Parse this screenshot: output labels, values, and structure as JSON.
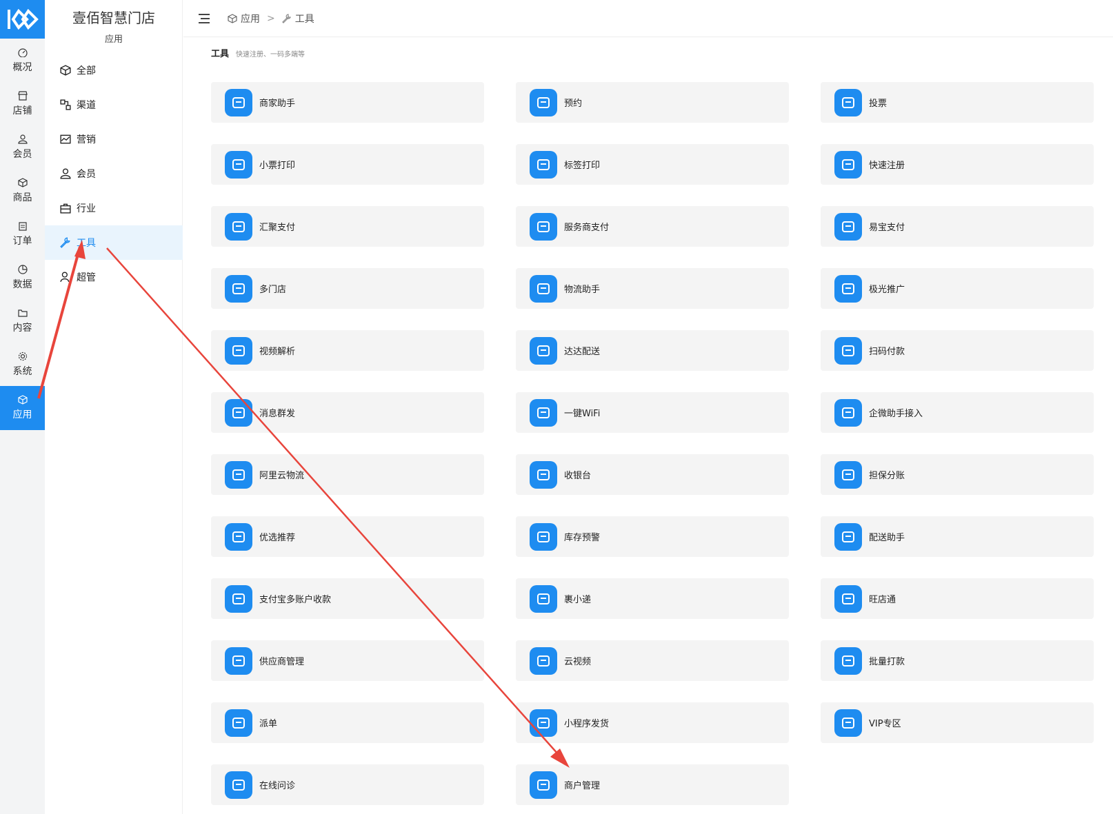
{
  "rail": [
    {
      "label": "概况",
      "icon": "dashboard-icon"
    },
    {
      "label": "店铺",
      "icon": "store-icon"
    },
    {
      "label": "会员",
      "icon": "user-icon"
    },
    {
      "label": "商品",
      "icon": "box-icon"
    },
    {
      "label": "订单",
      "icon": "clipboard-icon"
    },
    {
      "label": "数据",
      "icon": "pie-chart-icon"
    },
    {
      "label": "内容",
      "icon": "folder-icon"
    },
    {
      "label": "系统",
      "icon": "gear-icon"
    },
    {
      "label": "应用",
      "icon": "cube-icon",
      "active": true
    }
  ],
  "sidebar": {
    "title": "壹佰智慧门店",
    "subtitle": "应用",
    "items": [
      {
        "label": "全部"
      },
      {
        "label": "渠道"
      },
      {
        "label": "营销"
      },
      {
        "label": "会员"
      },
      {
        "label": "行业"
      },
      {
        "label": "工具",
        "active": true
      },
      {
        "label": "超管"
      }
    ]
  },
  "breadcrumb": {
    "root": "应用",
    "sep": ">",
    "current": "工具"
  },
  "section": {
    "title": "工具",
    "desc": "快速注册、一码多端等"
  },
  "tools": [
    "商家助手",
    "预约",
    "投票",
    "小票打印",
    "标签打印",
    "快速注册",
    "汇聚支付",
    "服务商支付",
    "易宝支付",
    "多门店",
    "物流助手",
    "极光推广",
    "视频解析",
    "达达配送",
    "扫码付款",
    "消息群发",
    "一键WiFi",
    "企微助手接入",
    "阿里云物流",
    "收银台",
    "担保分账",
    "优选推荐",
    "库存预警",
    "配送助手",
    "支付宝多账户收款",
    "裹小递",
    "旺店通",
    "供应商管理",
    "云视频",
    "批量打款",
    "派单",
    "小程序发货",
    "VIP专区",
    "在线问诊",
    "商户管理"
  ],
  "colors": {
    "accent": "#1e8cf0",
    "annotation": "#e8453c",
    "card_bg": "#f4f4f4"
  }
}
